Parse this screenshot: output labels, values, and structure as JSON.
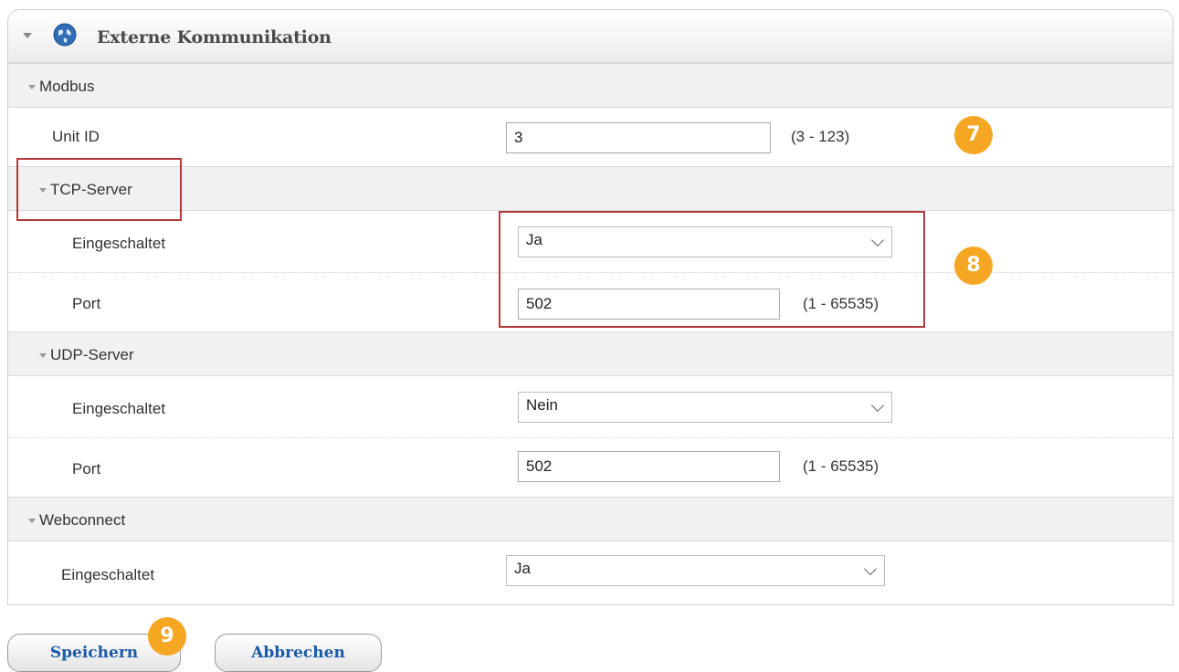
{
  "panel": {
    "title": "Externe Kommunikation"
  },
  "sections": {
    "modbus": {
      "label": "Modbus"
    },
    "tcp": {
      "label": "TCP-Server"
    },
    "udp": {
      "label": "UDP-Server"
    },
    "webconnect": {
      "label": "Webconnect"
    }
  },
  "fields": {
    "unit_id": {
      "label": "Unit ID",
      "value": "3",
      "range": "(3 - 123)"
    },
    "tcp_enabled": {
      "label": "Eingeschaltet",
      "value": "Ja"
    },
    "tcp_port": {
      "label": "Port",
      "value": "502",
      "range": "(1 - 65535)"
    },
    "udp_enabled": {
      "label": "Eingeschaltet",
      "value": "Nein"
    },
    "udp_port": {
      "label": "Port",
      "value": "502",
      "range": "(1 - 65535)"
    },
    "web_enabled": {
      "label": "Eingeschaltet",
      "value": "Ja"
    }
  },
  "badges": {
    "b7": "7",
    "b8": "8",
    "b9": "9"
  },
  "buttons": {
    "save": "Speichern",
    "cancel": "Abbrechen"
  },
  "colors": {
    "badge": "#f5a623",
    "highlight": "#b23a3a",
    "button_text": "#1a5aa8"
  }
}
